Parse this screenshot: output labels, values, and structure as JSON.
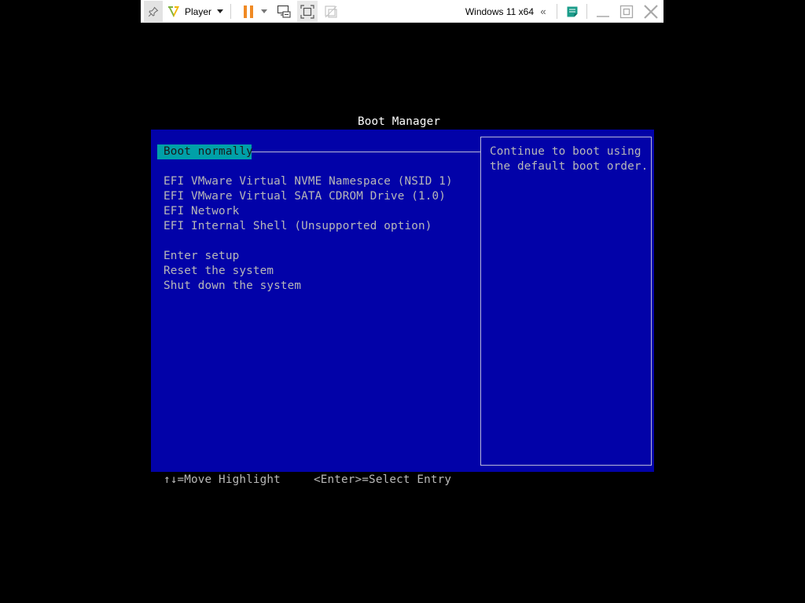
{
  "toolbar": {
    "player_label": "Player",
    "vm_name": "Windows 11 x64",
    "collapse_glyph": "«",
    "icons": {
      "pin": "pin-icon",
      "player_logo": "vmware-player-logo",
      "player_caret": "chevron-down-icon",
      "pause": "pause-icon",
      "pause_caret": "chevron-down-icon",
      "send_keys": "send-ctrl-alt-del-icon",
      "fullscreen": "fullscreen-icon",
      "unity": "unity-icon",
      "notes": "notes-icon",
      "minimize": "minimize-icon",
      "restore": "restore-icon",
      "close": "close-icon"
    },
    "colors": {
      "pause_orange": "#f08a24",
      "logo_green": "#7cb342",
      "logo_yellow": "#f2b705",
      "notes_teal": "#1a9c8a"
    }
  },
  "boot_manager": {
    "title": "Boot Manager",
    "selected_item": "Boot normally",
    "device_items": [
      "EFI VMware Virtual NVME Namespace (NSID 1)",
      "EFI VMware Virtual SATA CDROM Drive (1.0)",
      "EFI Network",
      "EFI Internal Shell (Unsupported option)"
    ],
    "action_items": [
      "Enter setup",
      "Reset the system",
      "Shut down the system"
    ],
    "help_text": [
      "Continue to boot using",
      "the default boot order."
    ],
    "footer": {
      "move_hint": "↑↓=Move Highlight",
      "select_hint": "<Enter>=Select Entry"
    },
    "colors": {
      "background": "#0202a8",
      "highlight": "#00a0a8",
      "text": "#b8b8b8",
      "title": "#ffffff"
    }
  }
}
